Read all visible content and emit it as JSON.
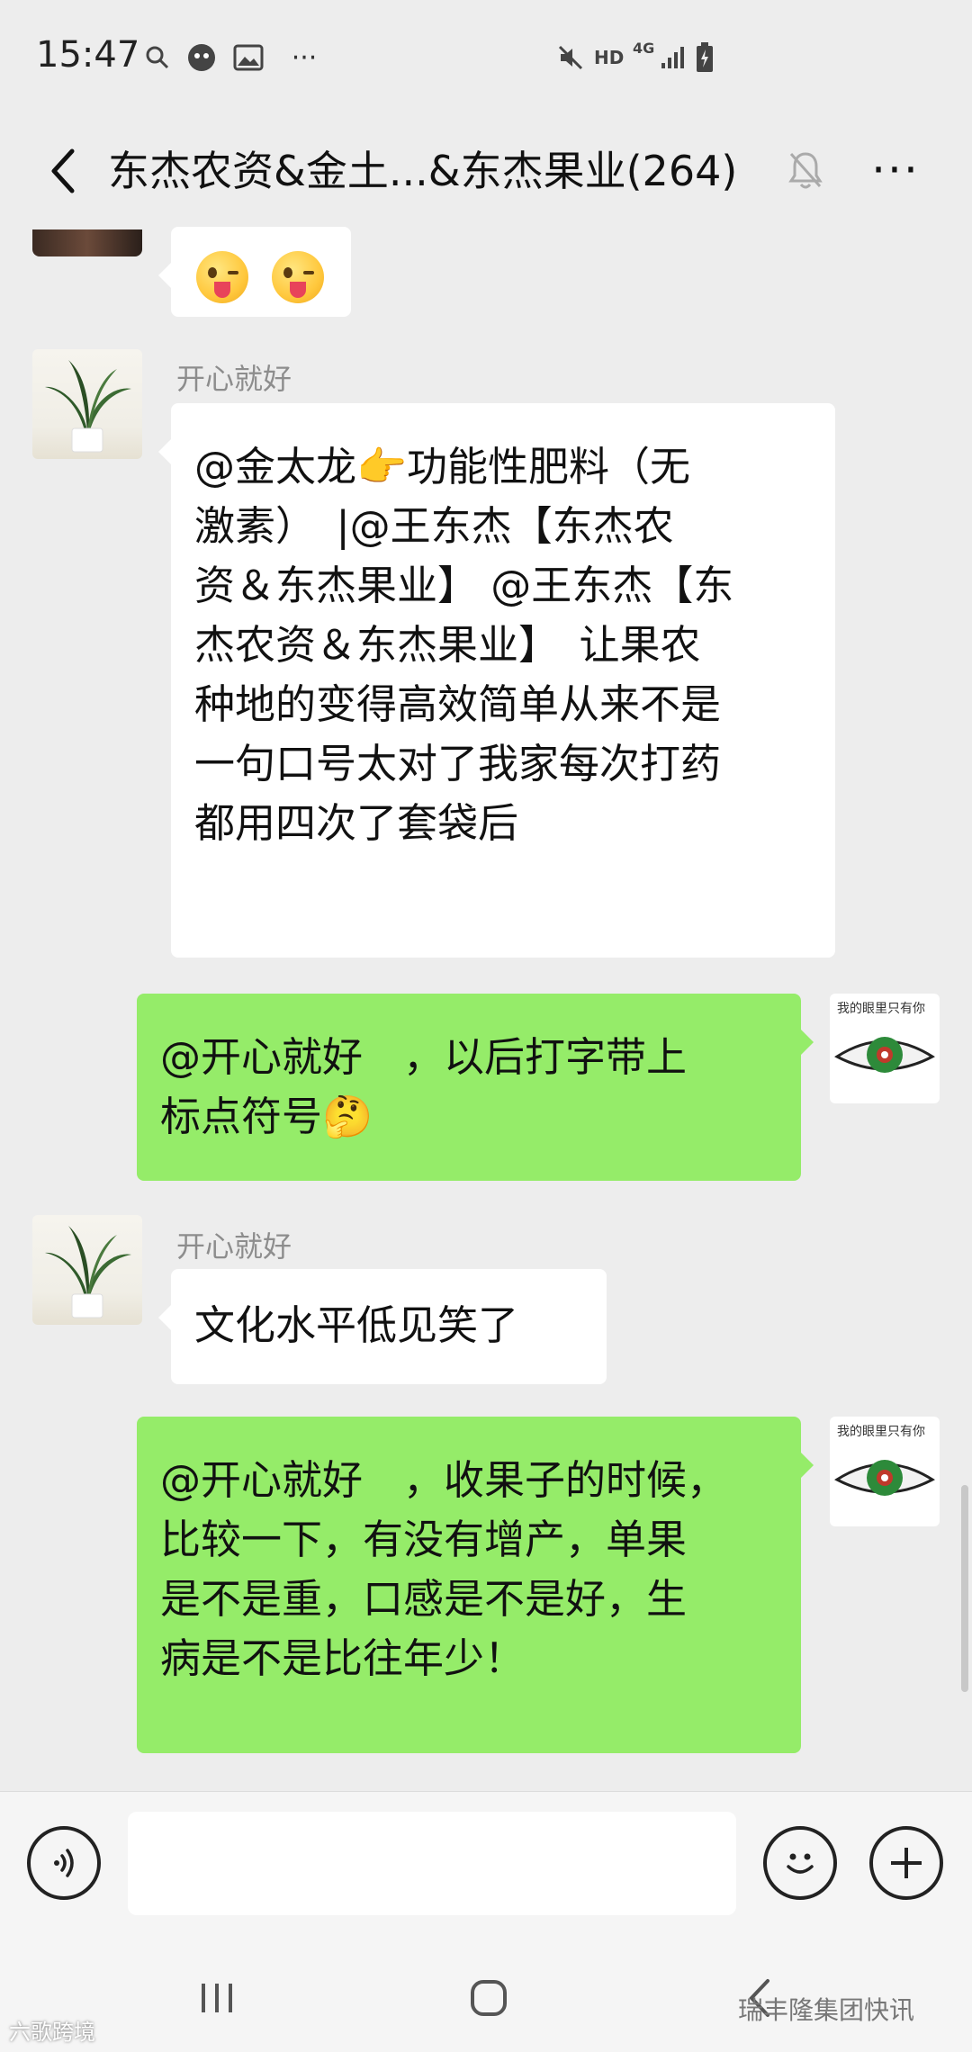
{
  "status_bar": {
    "time": "15:47",
    "hd_label": "HD",
    "network_label": "4G",
    "icons": [
      "search-icon",
      "qq-icon",
      "image-icon",
      "more-dots-icon",
      "mute-icon",
      "signal-icon",
      "battery-icon"
    ]
  },
  "header": {
    "title": "东杰农资&金土...&东杰果业(264)",
    "more_label": "···"
  },
  "messages": [
    {
      "side": "left",
      "sender": "开心就好",
      "text": "@金太龙👉功能性肥料（无\n激素）　|@王东杰【东杰农\n资＆东杰果业】 @王东杰【东\n杰农资＆东杰果业】　让果农\n种地的变得高效简单从来不是\n一句口号太对了我家每次打药\n都用四次了套袋后"
    },
    {
      "side": "right",
      "text": "@开心就好　，以后打字带上\n标点符号🤔"
    },
    {
      "side": "left",
      "sender": "开心就好",
      "text": "文化水平低见笑了"
    },
    {
      "side": "right",
      "text": "@开心就好　，收果子的时候，\n比较一下，有没有增产，单果\n是不是重，口感是不是好，生\n病是不是比往年少！"
    }
  ],
  "eye_avatar_caption": "我的眼里只有你",
  "input": {
    "value": "",
    "placeholder": ""
  },
  "watermarks": {
    "left": "六歌跨境",
    "right": "瑞丰隆集团快讯"
  },
  "colors": {
    "background": "#ededed",
    "incoming_bubble": "#ffffff",
    "outgoing_bubble": "#95ec69"
  }
}
